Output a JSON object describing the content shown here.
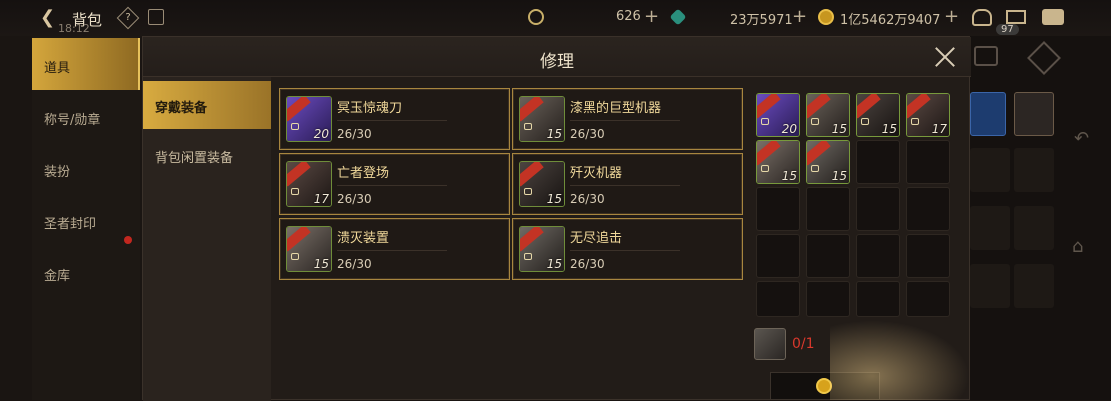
{
  "topbar": {
    "title": "背包",
    "time": "18:12",
    "currencies": [
      {
        "name": "gold-c-coin",
        "value": "626"
      },
      {
        "name": "green-crystal",
        "value": "23万5971"
      },
      {
        "name": "gold-coin",
        "value": "1亿5462万9407"
      }
    ],
    "badge": "97"
  },
  "sidebar": {
    "items": [
      {
        "label": "道具",
        "active": true
      },
      {
        "label": "称号/勋章"
      },
      {
        "label": "装扮"
      },
      {
        "label": "圣者封印",
        "alert": true
      },
      {
        "label": "金库"
      }
    ]
  },
  "modal": {
    "title": "修理",
    "tabs": [
      {
        "label": "穿戴装备",
        "active": true
      },
      {
        "label": "背包闲置装备"
      }
    ],
    "cards": [
      {
        "name": "冥玉惊魂刀",
        "durability": "26/30",
        "level": "20",
        "color": "#5a3fa0"
      },
      {
        "name": "漆黑的巨型机器",
        "durability": "26/30",
        "level": "15",
        "color": "#4a4440"
      },
      {
        "name": "亡者登场",
        "durability": "26/30",
        "level": "17",
        "color": "#3a2f2b"
      },
      {
        "name": "歼灭机器",
        "durability": "26/30",
        "level": "15",
        "color": "#2f2a28"
      },
      {
        "name": "溃灭装置",
        "durability": "26/30",
        "level": "15",
        "color": "#45403a"
      },
      {
        "name": "无尽追击",
        "durability": "26/30",
        "level": "15",
        "color": "#3e3a36"
      }
    ],
    "grid_items": [
      {
        "level": "20",
        "color": "#5a3fa0"
      },
      {
        "level": "15",
        "color": "#4a4440"
      },
      {
        "level": "15",
        "color": "#3a2f2b"
      },
      {
        "level": "17",
        "color": "#3a2f2b"
      },
      {
        "level": "15",
        "color": "#45403a"
      },
      {
        "level": "15",
        "color": "#3e3a36"
      }
    ],
    "material_count": "0/1"
  }
}
